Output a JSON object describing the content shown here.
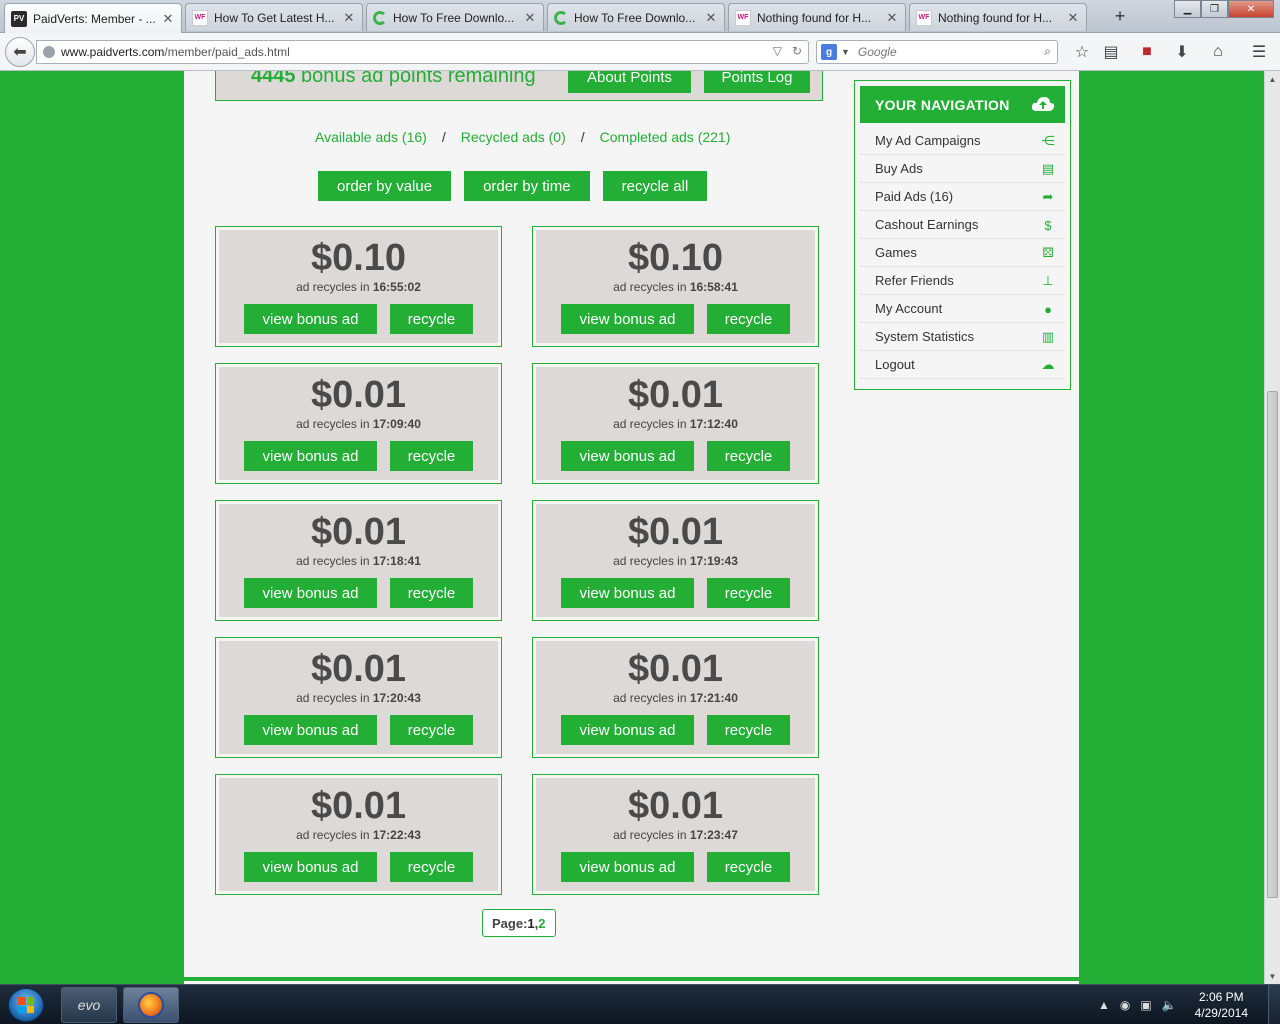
{
  "browser": {
    "tabs": [
      {
        "title": "PaidVerts: Member - ...",
        "favicon": "PV",
        "active": true
      },
      {
        "title": "How To Get Latest H...",
        "favicon": "WF",
        "active": false
      },
      {
        "title": "How To Free Downlo...",
        "favicon": "loading",
        "active": false
      },
      {
        "title": "How To Free Downlo...",
        "favicon": "loading",
        "active": false
      },
      {
        "title": "Nothing found for H...",
        "favicon": "WF",
        "active": false
      },
      {
        "title": "Nothing found for H...",
        "favicon": "WF",
        "active": false
      }
    ],
    "url_host": "www.paidverts.com",
    "url_path": "/member/paid_ads.html",
    "search_engine_glyph": "g",
    "search_placeholder": "Google"
  },
  "points_panel": {
    "points": "4445",
    "points_suffix": " bonus ad points remaining",
    "about_label": "About Points",
    "log_label": "Points Log"
  },
  "filters": {
    "available": "Available ads (16)",
    "recycled": "Recycled ads (0)",
    "completed": "Completed ads (221)",
    "separator": "/"
  },
  "order_buttons": {
    "by_value": "order by value",
    "by_time": "order by time",
    "recycle_all": "recycle all"
  },
  "ad_labels": {
    "recycles_prefix": "ad recycles in ",
    "view": "view bonus ad",
    "recycle": "recycle"
  },
  "ads": [
    {
      "value": "$0.10",
      "time": "16:55:02"
    },
    {
      "value": "$0.10",
      "time": "16:58:41"
    },
    {
      "value": "$0.01",
      "time": "17:09:40"
    },
    {
      "value": "$0.01",
      "time": "17:12:40"
    },
    {
      "value": "$0.01",
      "time": "17:18:41"
    },
    {
      "value": "$0.01",
      "time": "17:19:43"
    },
    {
      "value": "$0.01",
      "time": "17:20:43"
    },
    {
      "value": "$0.01",
      "time": "17:21:40"
    },
    {
      "value": "$0.01",
      "time": "17:22:43"
    },
    {
      "value": "$0.01",
      "time": "17:23:47"
    }
  ],
  "pager": {
    "label": "Page: ",
    "current": "1",
    "sep": ", ",
    "next": "2"
  },
  "sidenav": {
    "title": "YOUR NAVIGATION",
    "items": [
      {
        "label": "My Ad Campaigns",
        "icon": "share-icon"
      },
      {
        "label": "Buy Ads",
        "icon": "cash-icon"
      },
      {
        "label": "Paid Ads (16)",
        "icon": "folder-share-icon"
      },
      {
        "label": "Cashout Earnings",
        "icon": "money-bag-icon"
      },
      {
        "label": "Games",
        "icon": "dice-icon"
      },
      {
        "label": "Refer Friends",
        "icon": "sitemap-icon"
      },
      {
        "label": "My Account",
        "icon": "user-icon"
      },
      {
        "label": "System Statistics",
        "icon": "stats-icon"
      },
      {
        "label": "Logout",
        "icon": "cloud-icon"
      }
    ]
  },
  "taskbar": {
    "app1_label": "evo",
    "time": "2:06 PM",
    "date": "4/29/2014"
  },
  "colors": {
    "brand_green": "#23ae35",
    "panel_gray": "#dcd9d6",
    "page_bg": "#f5f5f5"
  }
}
